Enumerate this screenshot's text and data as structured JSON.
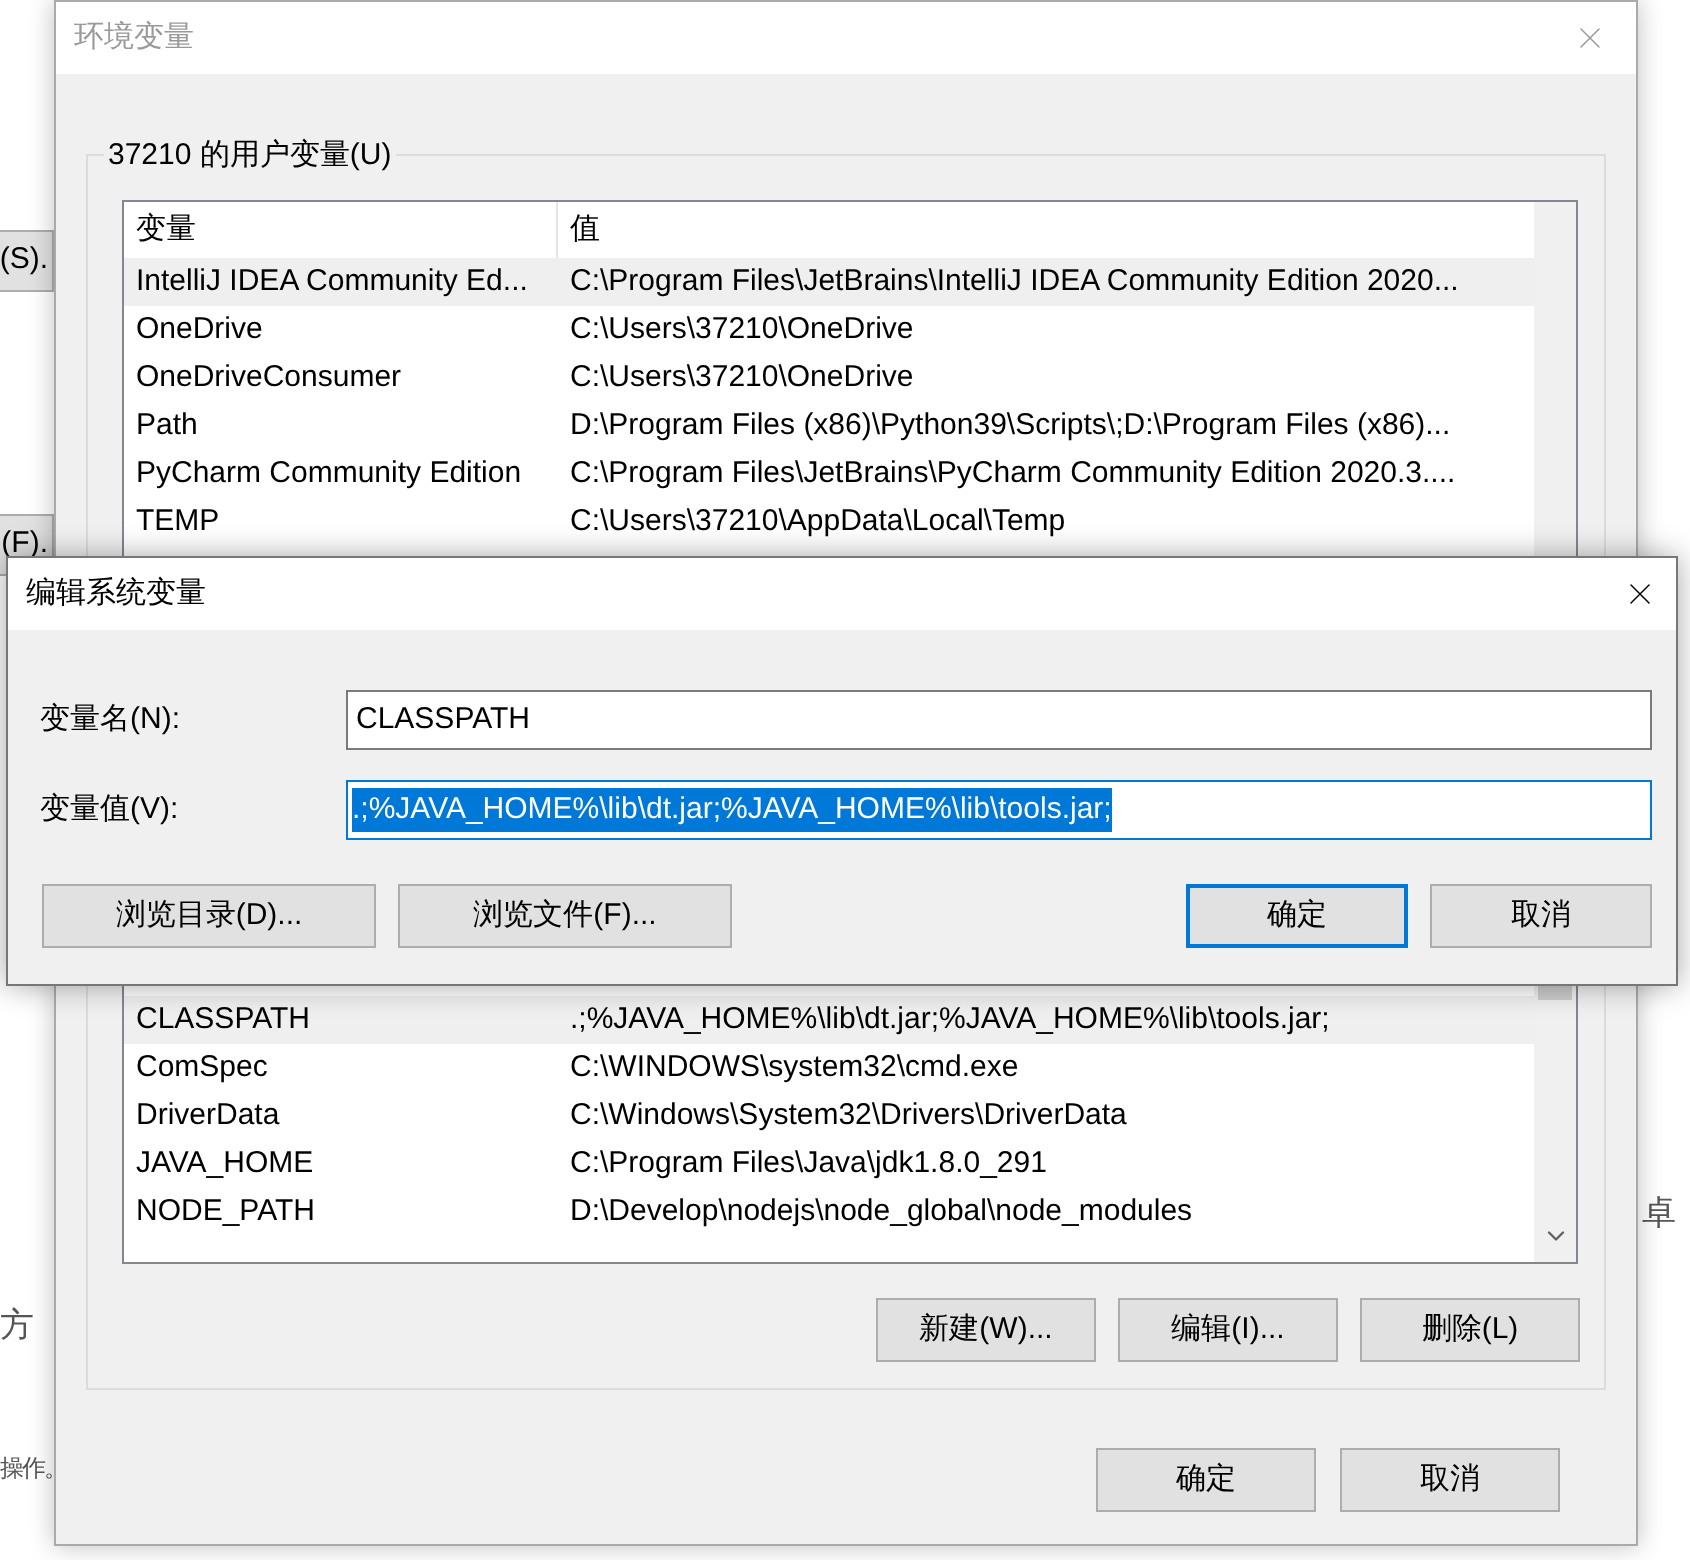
{
  "background": {
    "buttons": [
      "(S).",
      "(F)."
    ],
    "texts": [
      "方",
      "操作。",
      "卓"
    ]
  },
  "env_window": {
    "title": "环境变量",
    "user_vars": {
      "label": "37210 的用户变量(U)",
      "columns": [
        "变量",
        "值"
      ],
      "rows": [
        {
          "name": "IntelliJ IDEA Community Ed...",
          "value": "C:\\Program Files\\JetBrains\\IntelliJ IDEA Community Edition 2020...",
          "selected": true
        },
        {
          "name": "OneDrive",
          "value": "C:\\Users\\37210\\OneDrive",
          "selected": false
        },
        {
          "name": "OneDriveConsumer",
          "value": "C:\\Users\\37210\\OneDrive",
          "selected": false
        },
        {
          "name": "Path",
          "value": "D:\\Program Files (x86)\\Python39\\Scripts\\;D:\\Program Files (x86)...",
          "selected": false
        },
        {
          "name": "PyCharm Community Edition",
          "value": "C:\\Program Files\\JetBrains\\PyCharm Community Edition 2020.3....",
          "selected": false
        },
        {
          "name": "TEMP",
          "value": "C:\\Users\\37210\\AppData\\Local\\Temp",
          "selected": false
        }
      ]
    },
    "system_vars": {
      "rows": [
        {
          "name": "CLASSPATH",
          "value": ".;%JAVA_HOME%\\lib\\dt.jar;%JAVA_HOME%\\lib\\tools.jar;",
          "selected": true
        },
        {
          "name": "ComSpec",
          "value": "C:\\WINDOWS\\system32\\cmd.exe",
          "selected": false
        },
        {
          "name": "DriverData",
          "value": "C:\\Windows\\System32\\Drivers\\DriverData",
          "selected": false
        },
        {
          "name": "JAVA_HOME",
          "value": "C:\\Program Files\\Java\\jdk1.8.0_291",
          "selected": false
        },
        {
          "name": "NODE_PATH",
          "value": "D:\\Develop\\nodejs\\node_global\\node_modules",
          "selected": false
        }
      ],
      "buttons": [
        "新建(W)...",
        "编辑(I)...",
        "删除(L)"
      ]
    },
    "buttons": [
      "确定",
      "取消"
    ]
  },
  "edit_dialog": {
    "title": "编辑系统变量",
    "fields": [
      {
        "label": "变量名(N):",
        "value": "CLASSPATH",
        "text_selected": false
      },
      {
        "label": "变量值(V):",
        "value": ".;%JAVA_HOME%\\lib\\dt.jar;%JAVA_HOME%\\lib\\tools.jar;",
        "text_selected": true
      }
    ],
    "browse_buttons": [
      "浏览目录(D)...",
      "浏览文件(F)..."
    ],
    "buttons": [
      {
        "label": "确定",
        "default": true
      },
      {
        "label": "取消",
        "default": false
      }
    ]
  }
}
